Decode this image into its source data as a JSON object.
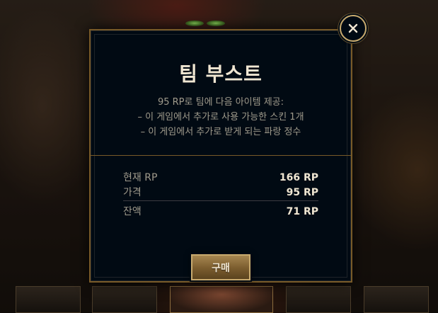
{
  "modal": {
    "title": "팀 부스트",
    "description": [
      "95 RP로 팀에 다음 아이템 제공:",
      "– 이 게임에서 추가로 사용 가능한 스킨 1개",
      "– 이 게임에서 추가로 받게 되는 파랑 정수"
    ],
    "prices": {
      "current_rp": {
        "label": "현재 RP",
        "value": "166 RP"
      },
      "cost": {
        "label": "가격",
        "value": "95 RP"
      },
      "balance": {
        "label": "잔액",
        "value": "71 RP"
      }
    },
    "buy_button_label": "구매",
    "close_icon": "close-icon"
  },
  "colors": {
    "gold": "#c8aa6e",
    "gold_dark": "#785a28",
    "text_light": "#f0e6d2",
    "text_muted": "#a09b8c",
    "panel_bg": "#010a13"
  }
}
